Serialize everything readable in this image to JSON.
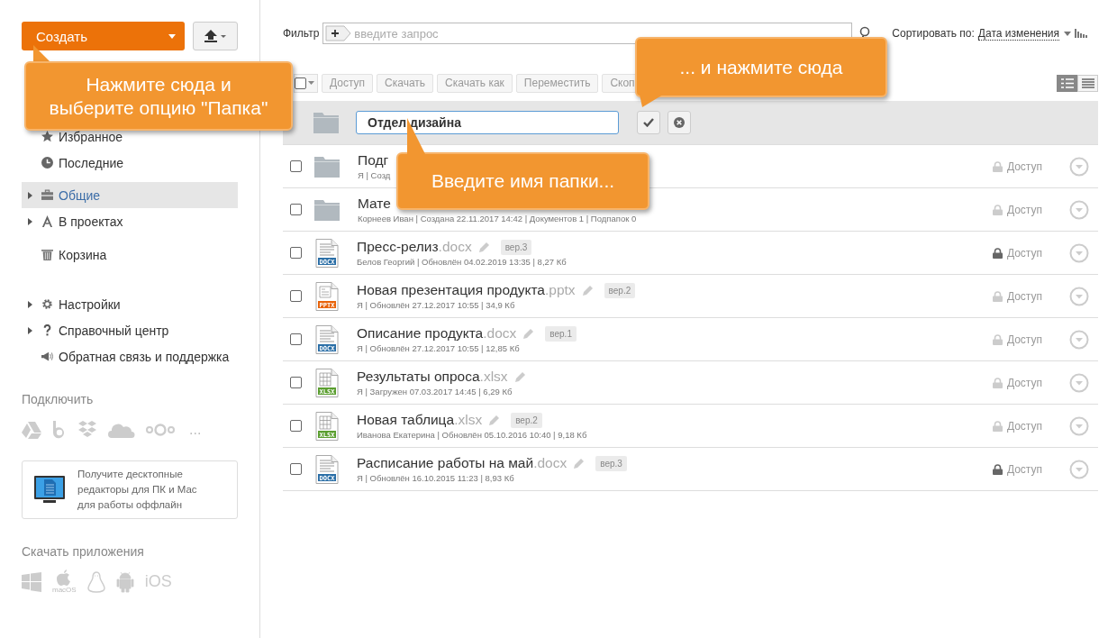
{
  "create_button": {
    "label": "Создать"
  },
  "sidebar": {
    "sections": [
      [
        {
          "label": "Избранное",
          "kind": "star",
          "expandable": false,
          "selected": false
        },
        {
          "label": "Последние",
          "kind": "clock",
          "expandable": false,
          "selected": false
        }
      ],
      [
        {
          "label": "Общие",
          "kind": "briefcase",
          "expandable": true,
          "selected": true
        },
        {
          "label": "В проектах",
          "kind": "compass",
          "expandable": true,
          "selected": false
        }
      ],
      [
        {
          "label": "Корзина",
          "kind": "trash",
          "expandable": false,
          "selected": false
        }
      ],
      [
        {
          "label": "Настройки",
          "kind": "gear",
          "expandable": true,
          "selected": false
        },
        {
          "label": "Справочный центр",
          "kind": "question",
          "expandable": true,
          "selected": false
        },
        {
          "label": "Обратная связь и поддержка",
          "kind": "megaphone",
          "expandable": false,
          "selected": false
        }
      ]
    ]
  },
  "connect": {
    "title": "Подключить",
    "more": "..."
  },
  "promo": {
    "lines": [
      "Получите десктопные",
      "редакторы для ПК и Mac",
      "для работы оффлайн"
    ]
  },
  "apps": {
    "title": "Скачать приложения",
    "mac_label": "macOS",
    "ios_label": "iOS"
  },
  "filter": {
    "label": "Фильтр",
    "placeholder": "введите запрос"
  },
  "sort": {
    "label": "Сортировать по:",
    "value": "Дата изменения"
  },
  "toolbar": {
    "select_all": {
      "checked": false
    },
    "buttons": [
      {
        "label": "Доступ",
        "disabled": true
      },
      {
        "label": "Скачать",
        "disabled": true
      },
      {
        "label": "Скачать как",
        "disabled": true
      },
      {
        "label": "Переместить",
        "disabled": true
      },
      {
        "label": "Скоп",
        "disabled": true
      }
    ],
    "views": [
      {
        "kind": "details",
        "selected": true
      },
      {
        "kind": "list",
        "selected": false
      }
    ]
  },
  "new_folder": {
    "value": "Отдел дизайна"
  },
  "rows": [
    {
      "kind": "folder",
      "title": "Подг",
      "meta": "Я | Созд",
      "access": "Доступ",
      "shared": false,
      "checked": false
    },
    {
      "kind": "folder",
      "title": "Мате",
      "meta": "Корнеев Иван | Создана 22.11.2017 14:42 | Документов 1 | Подпапок 0",
      "access": "Доступ",
      "shared": false,
      "checked": false
    },
    {
      "kind": "doc",
      "type_label": "DOCX",
      "title": "Пресс-релиз",
      "ext": ".docx",
      "version": "вер.3",
      "meta": "Белов Георгий | Обновлён 04.02.2019 13:35 | 8,27 Кб",
      "access": "Доступ",
      "shared": true,
      "checked": false
    },
    {
      "kind": "slides",
      "type_label": "PPTX",
      "title": "Новая презентация продукта",
      "ext": ".pptx",
      "version": "вер.2",
      "meta": "Я | Обновлён 27.12.2017 10:55 | 34,9 Кб",
      "access": "Доступ",
      "shared": false,
      "checked": false
    },
    {
      "kind": "doc",
      "type_label": "DOCX",
      "title": "Описание продукта",
      "ext": ".docx",
      "version": "вер.1",
      "meta": "Я | Обновлён 27.12.2017 10:55 | 12,85 Кб",
      "access": "Доступ",
      "shared": false,
      "checked": false
    },
    {
      "kind": "sheet",
      "type_label": "XLSX",
      "title": "Результаты опроса",
      "ext": ".xlsx",
      "meta": "Я | Загружен 07.03.2017 14:45 | 6,29 Кб",
      "access": "Доступ",
      "shared": false,
      "checked": false
    },
    {
      "kind": "sheet",
      "type_label": "XLSX",
      "title": "Новая таблица",
      "ext": ".xlsx",
      "version": "вер.2",
      "meta": "Иванова Екатерина | Обновлён 05.10.2016 10:40 | 9,18 Кб",
      "access": "Доступ",
      "shared": false,
      "checked": false
    },
    {
      "kind": "doc",
      "type_label": "DOCX",
      "title": "Расписание работы на май",
      "ext": ".docx",
      "version": "вер.3",
      "meta": "Я | Обновлён 16.10.2015 11:23 | 8,93 Кб",
      "access": "Доступ",
      "shared": true,
      "checked": false
    }
  ],
  "callouts": [
    {
      "lines": [
        "Нажмите сюда и",
        "выберите опцию \"Папка\""
      ]
    },
    {
      "lines": [
        "... и нажмите сюда"
      ]
    },
    {
      "lines": [
        "Введите имя папки..."
      ]
    }
  ]
}
